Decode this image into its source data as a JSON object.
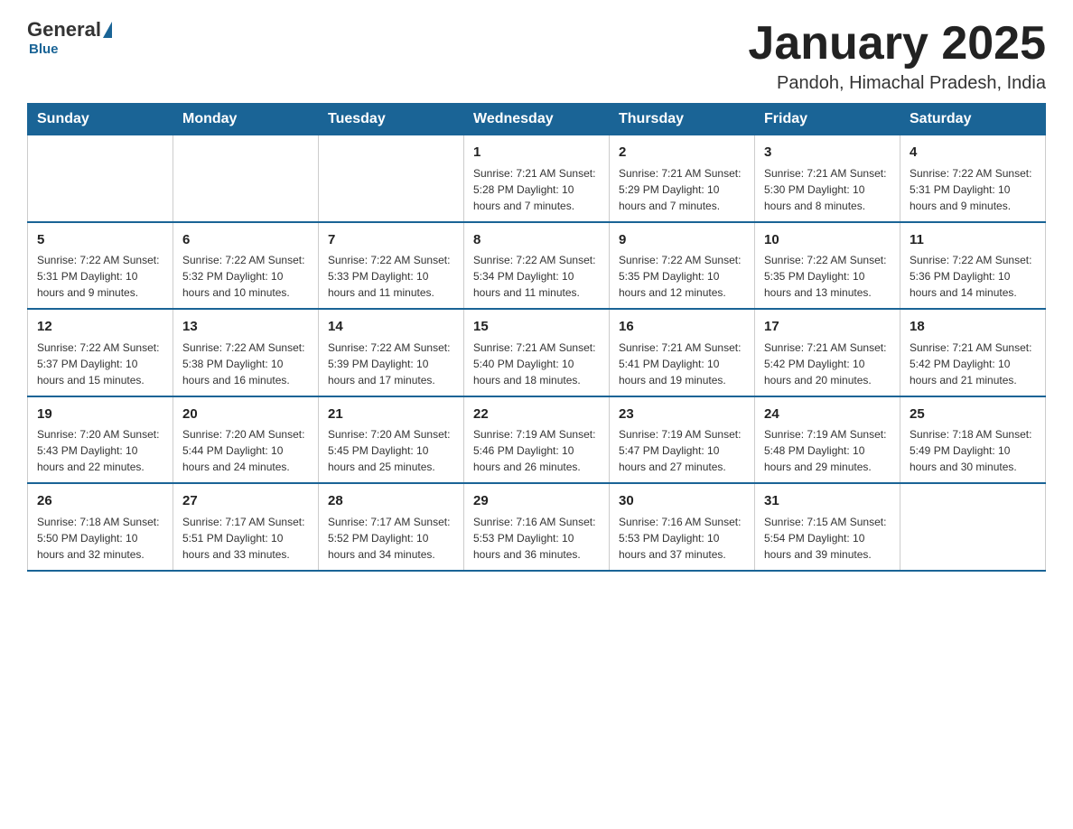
{
  "header": {
    "logo_general": "General",
    "logo_blue": "Blue",
    "title": "January 2025",
    "subtitle": "Pandoh, Himachal Pradesh, India"
  },
  "days_of_week": [
    "Sunday",
    "Monday",
    "Tuesday",
    "Wednesday",
    "Thursday",
    "Friday",
    "Saturday"
  ],
  "weeks": [
    [
      {
        "day": "",
        "info": ""
      },
      {
        "day": "",
        "info": ""
      },
      {
        "day": "",
        "info": ""
      },
      {
        "day": "1",
        "info": "Sunrise: 7:21 AM\nSunset: 5:28 PM\nDaylight: 10 hours and 7 minutes."
      },
      {
        "day": "2",
        "info": "Sunrise: 7:21 AM\nSunset: 5:29 PM\nDaylight: 10 hours and 7 minutes."
      },
      {
        "day": "3",
        "info": "Sunrise: 7:21 AM\nSunset: 5:30 PM\nDaylight: 10 hours and 8 minutes."
      },
      {
        "day": "4",
        "info": "Sunrise: 7:22 AM\nSunset: 5:31 PM\nDaylight: 10 hours and 9 minutes."
      }
    ],
    [
      {
        "day": "5",
        "info": "Sunrise: 7:22 AM\nSunset: 5:31 PM\nDaylight: 10 hours and 9 minutes."
      },
      {
        "day": "6",
        "info": "Sunrise: 7:22 AM\nSunset: 5:32 PM\nDaylight: 10 hours and 10 minutes."
      },
      {
        "day": "7",
        "info": "Sunrise: 7:22 AM\nSunset: 5:33 PM\nDaylight: 10 hours and 11 minutes."
      },
      {
        "day": "8",
        "info": "Sunrise: 7:22 AM\nSunset: 5:34 PM\nDaylight: 10 hours and 11 minutes."
      },
      {
        "day": "9",
        "info": "Sunrise: 7:22 AM\nSunset: 5:35 PM\nDaylight: 10 hours and 12 minutes."
      },
      {
        "day": "10",
        "info": "Sunrise: 7:22 AM\nSunset: 5:35 PM\nDaylight: 10 hours and 13 minutes."
      },
      {
        "day": "11",
        "info": "Sunrise: 7:22 AM\nSunset: 5:36 PM\nDaylight: 10 hours and 14 minutes."
      }
    ],
    [
      {
        "day": "12",
        "info": "Sunrise: 7:22 AM\nSunset: 5:37 PM\nDaylight: 10 hours and 15 minutes."
      },
      {
        "day": "13",
        "info": "Sunrise: 7:22 AM\nSunset: 5:38 PM\nDaylight: 10 hours and 16 minutes."
      },
      {
        "day": "14",
        "info": "Sunrise: 7:22 AM\nSunset: 5:39 PM\nDaylight: 10 hours and 17 minutes."
      },
      {
        "day": "15",
        "info": "Sunrise: 7:21 AM\nSunset: 5:40 PM\nDaylight: 10 hours and 18 minutes."
      },
      {
        "day": "16",
        "info": "Sunrise: 7:21 AM\nSunset: 5:41 PM\nDaylight: 10 hours and 19 minutes."
      },
      {
        "day": "17",
        "info": "Sunrise: 7:21 AM\nSunset: 5:42 PM\nDaylight: 10 hours and 20 minutes."
      },
      {
        "day": "18",
        "info": "Sunrise: 7:21 AM\nSunset: 5:42 PM\nDaylight: 10 hours and 21 minutes."
      }
    ],
    [
      {
        "day": "19",
        "info": "Sunrise: 7:20 AM\nSunset: 5:43 PM\nDaylight: 10 hours and 22 minutes."
      },
      {
        "day": "20",
        "info": "Sunrise: 7:20 AM\nSunset: 5:44 PM\nDaylight: 10 hours and 24 minutes."
      },
      {
        "day": "21",
        "info": "Sunrise: 7:20 AM\nSunset: 5:45 PM\nDaylight: 10 hours and 25 minutes."
      },
      {
        "day": "22",
        "info": "Sunrise: 7:19 AM\nSunset: 5:46 PM\nDaylight: 10 hours and 26 minutes."
      },
      {
        "day": "23",
        "info": "Sunrise: 7:19 AM\nSunset: 5:47 PM\nDaylight: 10 hours and 27 minutes."
      },
      {
        "day": "24",
        "info": "Sunrise: 7:19 AM\nSunset: 5:48 PM\nDaylight: 10 hours and 29 minutes."
      },
      {
        "day": "25",
        "info": "Sunrise: 7:18 AM\nSunset: 5:49 PM\nDaylight: 10 hours and 30 minutes."
      }
    ],
    [
      {
        "day": "26",
        "info": "Sunrise: 7:18 AM\nSunset: 5:50 PM\nDaylight: 10 hours and 32 minutes."
      },
      {
        "day": "27",
        "info": "Sunrise: 7:17 AM\nSunset: 5:51 PM\nDaylight: 10 hours and 33 minutes."
      },
      {
        "day": "28",
        "info": "Sunrise: 7:17 AM\nSunset: 5:52 PM\nDaylight: 10 hours and 34 minutes."
      },
      {
        "day": "29",
        "info": "Sunrise: 7:16 AM\nSunset: 5:53 PM\nDaylight: 10 hours and 36 minutes."
      },
      {
        "day": "30",
        "info": "Sunrise: 7:16 AM\nSunset: 5:53 PM\nDaylight: 10 hours and 37 minutes."
      },
      {
        "day": "31",
        "info": "Sunrise: 7:15 AM\nSunset: 5:54 PM\nDaylight: 10 hours and 39 minutes."
      },
      {
        "day": "",
        "info": ""
      }
    ]
  ]
}
